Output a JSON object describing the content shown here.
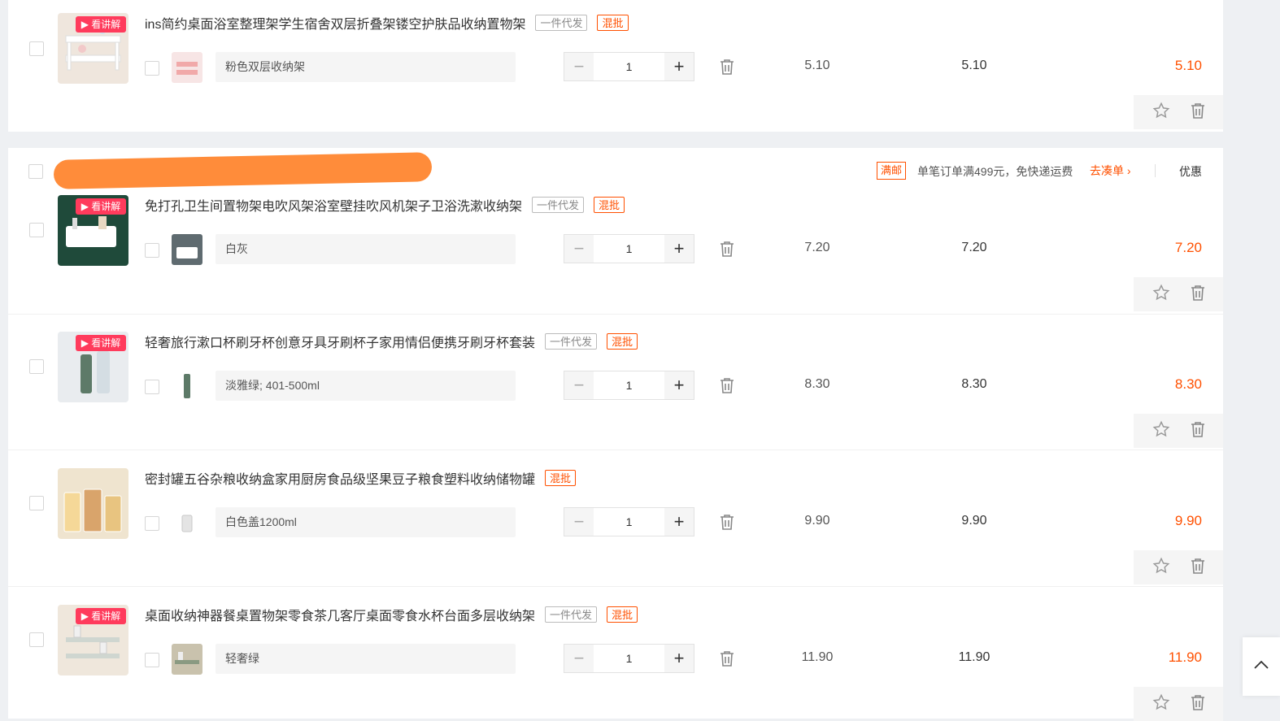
{
  "colors": {
    "accent": "#ff5000",
    "badge": "#ff3b5c",
    "redaction": "#ff8c3a"
  },
  "badge_label": "▶ 看讲解",
  "tag_dropship": "一件代发",
  "tag_mix": "混批",
  "store": {
    "shipping_tag": "满邮",
    "shipping_text": "单笔订单满499元，免快递运费",
    "go_link": "去凑单",
    "discount_label": "优惠"
  },
  "items": [
    {
      "title": "ins简约桌面浴室整理架学生宿舍双层折叠架镂空护肤品收纳置物架",
      "sku": "粉色双层收纳架",
      "qty": "1",
      "unit_price": "5.10",
      "subtotal": "5.10",
      "total": "5.10",
      "has_dropship": true
    },
    {
      "title": "免打孔卫生间置物架电吹风架浴室壁挂吹风机架子卫浴洗漱收纳架",
      "sku": "白灰",
      "qty": "1",
      "unit_price": "7.20",
      "subtotal": "7.20",
      "total": "7.20",
      "has_dropship": true
    },
    {
      "title": "轻奢旅行漱口杯刷牙杯创意牙具牙刷杯子家用情侣便携牙刷牙杯套装",
      "sku": "淡雅绿; 401-500ml",
      "qty": "1",
      "unit_price": "8.30",
      "subtotal": "8.30",
      "total": "8.30",
      "has_dropship": true
    },
    {
      "title": "密封罐五谷杂粮收纳盒家用厨房食品级坚果豆子粮食塑料收纳储物罐",
      "sku": "白色盖1200ml",
      "qty": "1",
      "unit_price": "9.90",
      "subtotal": "9.90",
      "total": "9.90",
      "has_dropship": false
    },
    {
      "title": "桌面收纳神器餐桌置物架零食茶几客厅桌面零食水杯台面多层收纳架",
      "sku": "轻奢绿",
      "qty": "1",
      "unit_price": "11.90",
      "subtotal": "11.90",
      "total": "11.90",
      "has_dropship": true
    }
  ]
}
